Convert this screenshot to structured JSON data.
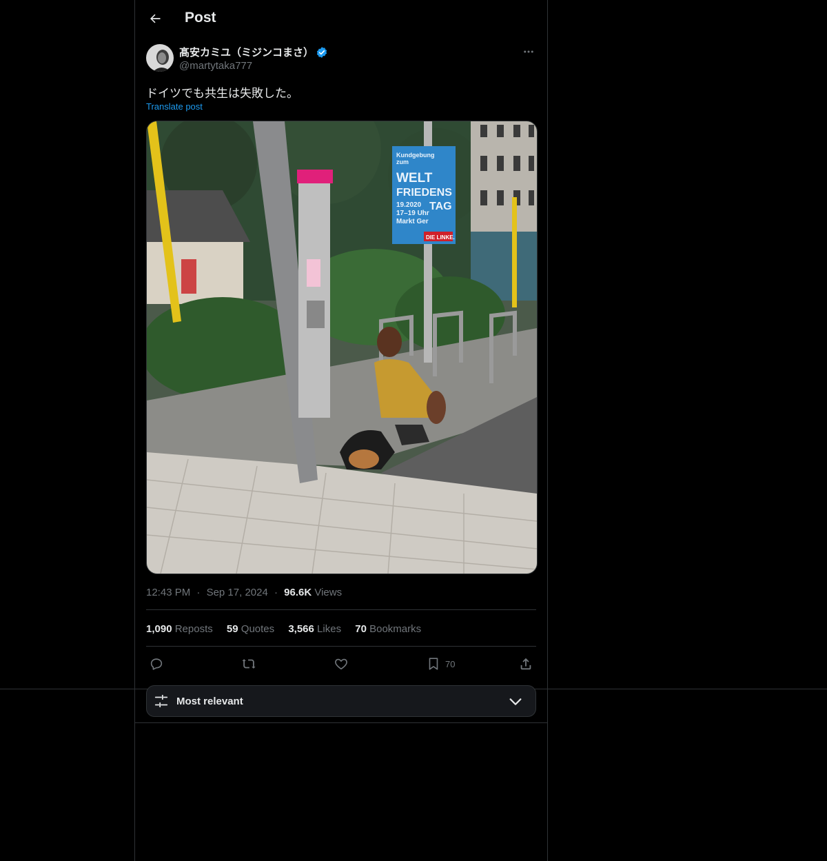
{
  "header": {
    "title": "Post",
    "back_icon": "arrow-left-icon"
  },
  "author": {
    "display_name": "髙安カミユ（ミジンコまさ）",
    "handle": "@martytaka777",
    "verified": true,
    "verified_color": "#1d9bf0"
  },
  "post": {
    "text": "ドイツでも共生は失敗した。",
    "translate_label": "Translate post",
    "media": {
      "poster_lines": [
        "Kundgebung",
        "zum",
        "WELT",
        "FRIEDENS",
        "TAG",
        "19.2020",
        "17–19 Uhr",
        "Markt Ger"
      ],
      "poster_logo": "DIE LINKE."
    }
  },
  "meta": {
    "time": "12:43 PM",
    "separator": "·",
    "date": "Sep 17, 2024",
    "views_count": "96.6K",
    "views_label": "Views"
  },
  "stats": [
    {
      "count": "1,090",
      "label": "Reposts"
    },
    {
      "count": "59",
      "label": "Quotes"
    },
    {
      "count": "3,566",
      "label": "Likes"
    },
    {
      "count": "70",
      "label": "Bookmarks"
    }
  ],
  "actions": {
    "reply_icon": "reply-icon",
    "repost_icon": "repost-icon",
    "like_icon": "heart-icon",
    "bookmark_icon": "bookmark-icon",
    "bookmark_count": "70",
    "share_icon": "share-icon"
  },
  "sort": {
    "label": "Most relevant",
    "icon": "sliders-icon",
    "chevron": "chevron-down-icon"
  },
  "colors": {
    "background": "#000000",
    "text": "#e7e9ea",
    "muted": "#71767b",
    "accent": "#1d9bf0",
    "border": "#2f3336"
  }
}
